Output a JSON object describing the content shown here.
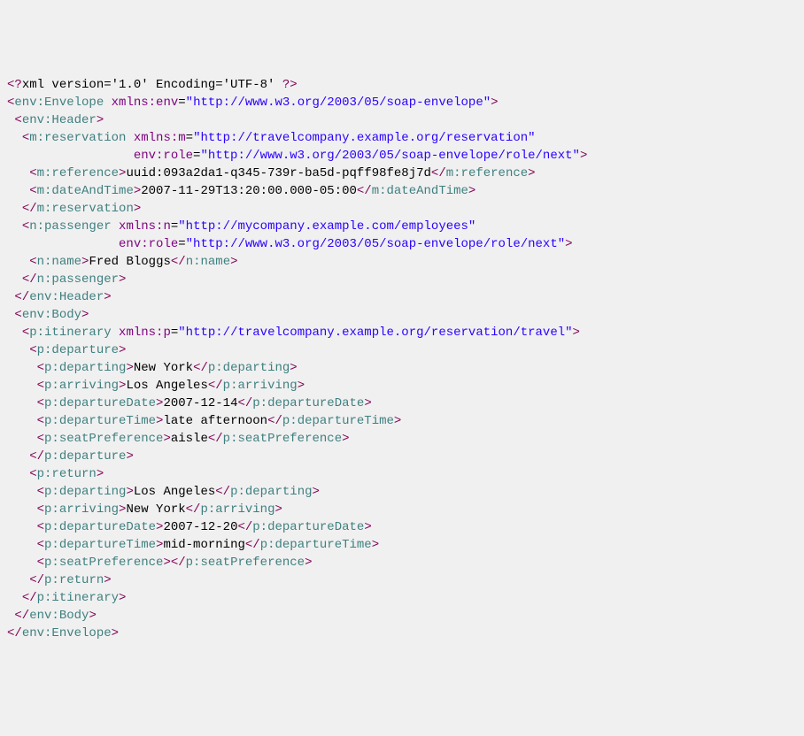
{
  "xmlDecl": {
    "raw": "xml version='1.0' Encoding='UTF-8' "
  },
  "envelope": {
    "open": "env:Envelope",
    "nsAttr": "xmlns:env",
    "nsVal": "\"http://www.w3.org/2003/05/soap-envelope\"",
    "close": "env:Envelope"
  },
  "header": {
    "open": "env:Header",
    "close": "env:Header"
  },
  "reservation": {
    "open": "m:reservation",
    "a1n": "xmlns:m",
    "a1v": "\"http://travelcompany.example.org/reservation\"",
    "a2n": "env:role",
    "a2v": "\"http://www.w3.org/2003/05/soap-envelope/role/next\"",
    "close": "m:reservation"
  },
  "reference": {
    "open": "m:reference",
    "text": "uuid:093a2da1-q345-739r-ba5d-pqff98fe8j7d",
    "close": "m:reference"
  },
  "dateAndTime": {
    "open": "m:dateAndTime",
    "text": "2007-11-29T13:20:00.000-05:00",
    "close": "m:dateAndTime"
  },
  "passenger": {
    "open": "n:passenger",
    "a1n": "xmlns:n",
    "a1v": "\"http://mycompany.example.com/employees\"",
    "a2n": "env:role",
    "a2v": "\"http://www.w3.org/2003/05/soap-envelope/role/next\"",
    "close": "n:passenger"
  },
  "name": {
    "open": "n:name",
    "text": "Fred Bloggs",
    "close": "n:name"
  },
  "body": {
    "open": "env:Body",
    "close": "env:Body"
  },
  "itinerary": {
    "open": "p:itinerary",
    "a1n": "xmlns:p",
    "a1v": "\"http://travelcompany.example.org/reservation/travel\"",
    "close": "p:itinerary"
  },
  "departure": {
    "open": "p:departure",
    "close": "p:departure",
    "departing": {
      "tag": "p:departing",
      "text": "New York"
    },
    "arriving": {
      "tag": "p:arriving",
      "text": "Los Angeles"
    },
    "depDate": {
      "tag": "p:departureDate",
      "text": "2007-12-14"
    },
    "depTime": {
      "tag": "p:departureTime",
      "text": "late afternoon"
    },
    "seat": {
      "tag": "p:seatPreference",
      "text": "aisle"
    }
  },
  "ret": {
    "open": "p:return",
    "close": "p:return",
    "departing": {
      "tag": "p:departing",
      "text": "Los Angeles"
    },
    "arriving": {
      "tag": "p:arriving",
      "text": "New York"
    },
    "depDate": {
      "tag": "p:departureDate",
      "text": "2007-12-20"
    },
    "depTime": {
      "tag": "p:departureTime",
      "text": "mid-morning"
    },
    "seat": {
      "tag": "p:seatPreference",
      "text": ""
    }
  }
}
